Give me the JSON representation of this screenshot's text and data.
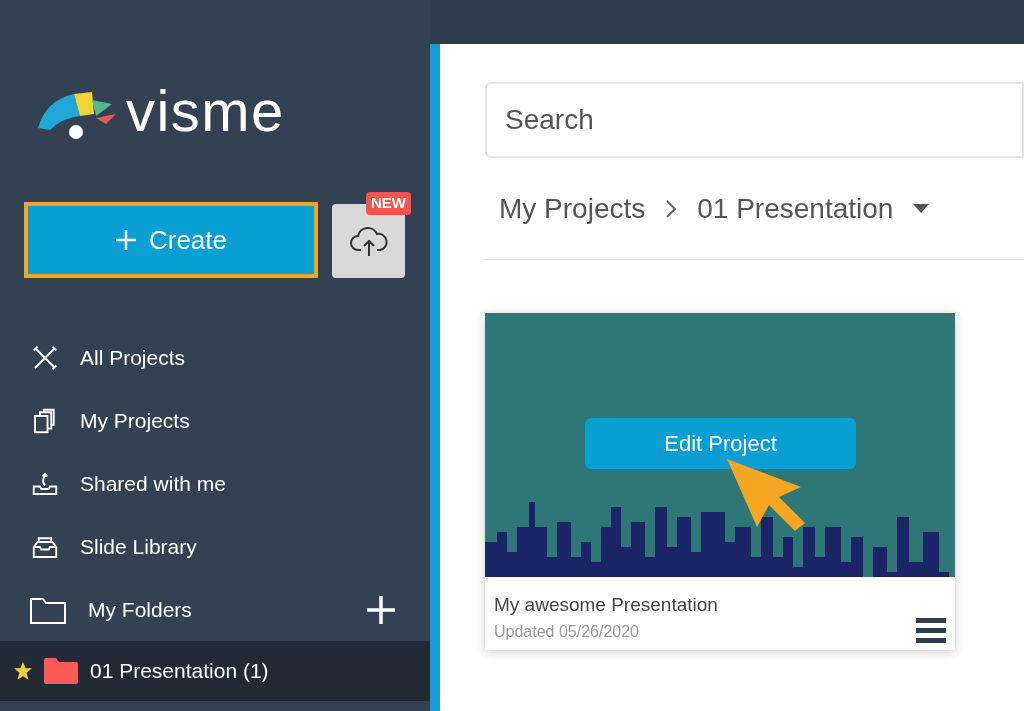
{
  "logo": {
    "text": "visme"
  },
  "create_button": {
    "label": "Create",
    "highlighted": true
  },
  "upload_button": {
    "badge": "NEW"
  },
  "nav_items": [
    {
      "label": "All Projects",
      "selected": false
    },
    {
      "label": "My Projects",
      "selected": false
    },
    {
      "label": "Shared with me",
      "selected": false
    },
    {
      "label": "Slide Library",
      "selected": false
    }
  ],
  "folders": {
    "label": "My Folders",
    "items": [
      {
        "label": "01 Presentation (1)",
        "starred": true,
        "color": "#ff5a5a",
        "selected": true
      }
    ]
  },
  "search": {
    "placeholder": "Search"
  },
  "breadcrumb": [
    "My Projects",
    "01 Presentation"
  ],
  "project": {
    "edit_label": "Edit Project",
    "name": "My awesome Presentation",
    "updated": "Updated 05/26/2020"
  }
}
